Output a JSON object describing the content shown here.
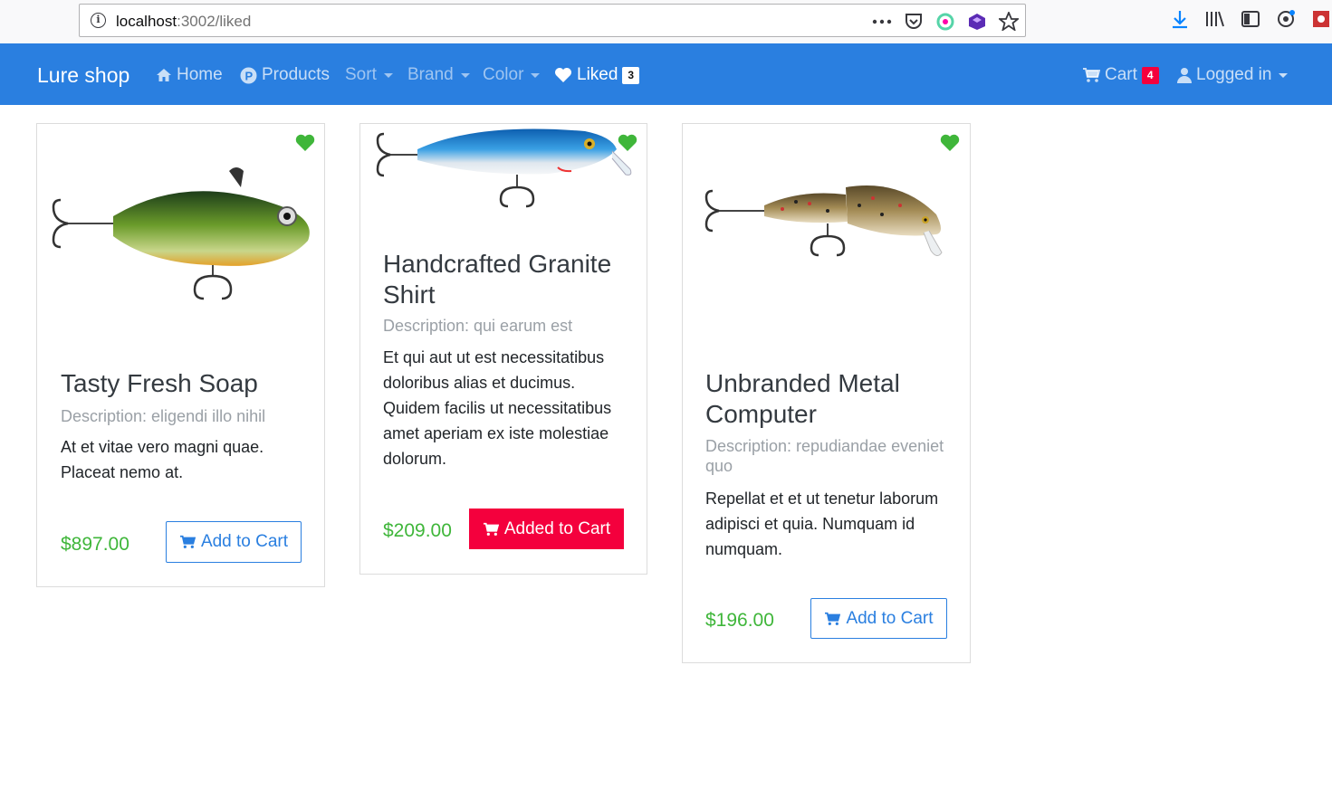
{
  "browser": {
    "url_host": "localhost",
    "url_path": ":3002/liked",
    "more_icon": "ellipsis-icon",
    "pocket_icon": "pocket-icon",
    "star_icon": "star-icon"
  },
  "navbar": {
    "brand": "Lure shop",
    "home": "Home",
    "products": "Products",
    "sort": "Sort",
    "brand_menu": "Brand",
    "color": "Color",
    "liked": "Liked",
    "liked_count": "3",
    "cart": "Cart",
    "cart_count": "4",
    "user": "Logged in"
  },
  "products": [
    {
      "title": "Tasty Fresh Soap",
      "description": "Description: eligendi illo nihil",
      "text": "At et vitae vero magni quae. Placeat nemo at.",
      "price": "$897.00",
      "button": "Add to Cart",
      "added": false
    },
    {
      "title": "Handcrafted Granite Shirt",
      "description": "Description: qui earum est",
      "text": "Et qui aut ut est necessitatibus doloribus alias et ducimus. Quidem facilis ut necessitatibus amet aperiam ex iste molestiae dolorum.",
      "price": "$209.00",
      "button": "Added to Cart",
      "added": true
    },
    {
      "title": "Unbranded Metal Computer",
      "description": "Description: repudiandae eveniet quo",
      "text": "Repellat et et ut tenetur laborum adipisci et quia. Numquam id numquam.",
      "price": "$196.00",
      "button": "Add to Cart",
      "added": false
    }
  ],
  "colors": {
    "navbar": "#2a7fe0",
    "heart": "#3fb63a",
    "price": "#3fb63a",
    "added_button": "#f4003d",
    "outline_button": "#2a7fe0"
  }
}
